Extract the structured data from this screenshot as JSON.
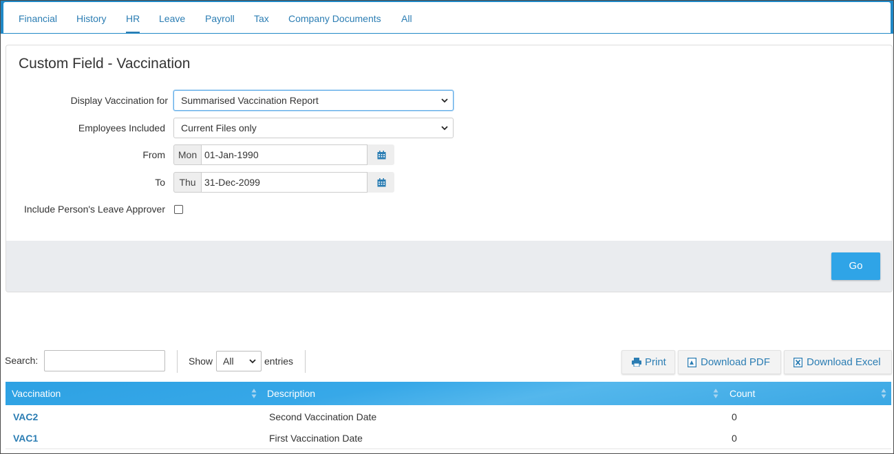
{
  "tabs": [
    {
      "label": "Financial"
    },
    {
      "label": "History"
    },
    {
      "label": "HR"
    },
    {
      "label": "Leave"
    },
    {
      "label": "Payroll"
    },
    {
      "label": "Tax"
    },
    {
      "label": "Company Documents"
    },
    {
      "label": "All"
    }
  ],
  "active_tab": "HR",
  "panel": {
    "title": "Custom Field - Vaccination",
    "display_for_label": "Display Vaccination for",
    "display_for_value": "Summarised Vaccination Report",
    "employees_label": "Employees Included",
    "employees_value": "Current Files only",
    "from_label": "From",
    "from_day": "Mon",
    "from_date": "01-Jan-1990",
    "to_label": "To",
    "to_day": "Thu",
    "to_date": "31-Dec-2099",
    "include_approver_label": "Include Person's Leave Approver",
    "include_approver_checked": false,
    "go_label": "Go"
  },
  "table_controls": {
    "search_label": "Search:",
    "search_value": "",
    "show_label": "Show",
    "length_value": "All",
    "entries_label": "entries",
    "print_label": "Print",
    "pdf_label": "Download PDF",
    "excel_label": "Download Excel"
  },
  "table": {
    "columns": [
      "Vaccination",
      "Description",
      "Count"
    ],
    "rows": [
      {
        "code": "VAC2",
        "description": "Second Vaccination Date",
        "count": "0"
      },
      {
        "code": "VAC1",
        "description": "First Vaccination Date",
        "count": "0"
      }
    ]
  },
  "colors": {
    "accent": "#1f88c6",
    "link": "#2b7db3",
    "button": "#2fa4e7",
    "header": "#37a8e8"
  }
}
